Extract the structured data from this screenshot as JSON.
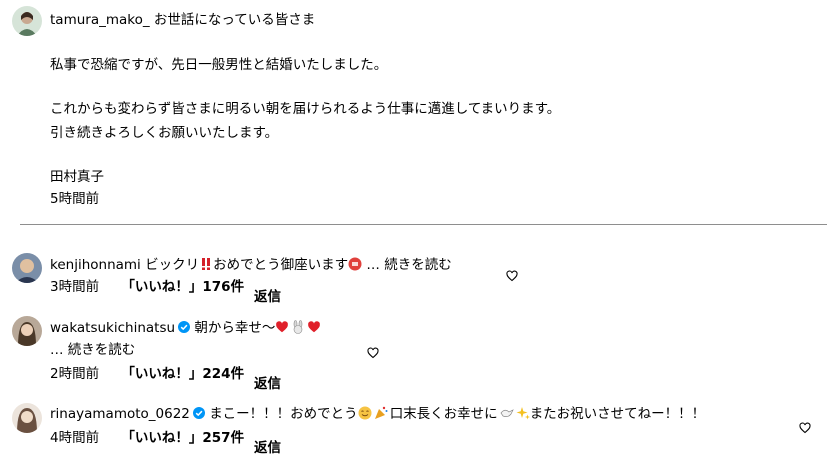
{
  "post": {
    "username": "tamura_mako_",
    "line1": "お世話になっている皆さま",
    "line2": "私事で恐縮ですが、先日一般男性と結婚いたしました。",
    "line3": "これからも変わらず皆さまに明るい朝を届けられるよう仕事に邁進してまいります。",
    "line4": "引き続きよろしくお願いいたします。",
    "signature": "田村真子",
    "time": "5時間前"
  },
  "comments": [
    {
      "username": "kenjihonnami",
      "text_a": "ビックリ",
      "text_b": "おめでとう御座います",
      "text_c": "… 続きを読む",
      "time": "3時間前",
      "likes": "「いいね！」176件",
      "reply": "返信"
    },
    {
      "username": "wakatsukichinatsu",
      "text_a": "朝から幸せ〜",
      "text_c": "… 続きを読む",
      "time": "2時間前",
      "likes": "「いいね！」224件",
      "reply": "返信"
    },
    {
      "username": "rinayamamoto_0622",
      "text_a": "まこー！！！おめでとう",
      "text_b": "口末長くお幸せに",
      "text_c": "またお祝いさせてねー！！！",
      "time": "4時間前",
      "likes": "「いいね！」257件",
      "reply": "返信"
    }
  ],
  "icons": {
    "like": "heart-outline-icon",
    "verified": "verified-badge-icon",
    "verified_color": "#0095f6"
  }
}
